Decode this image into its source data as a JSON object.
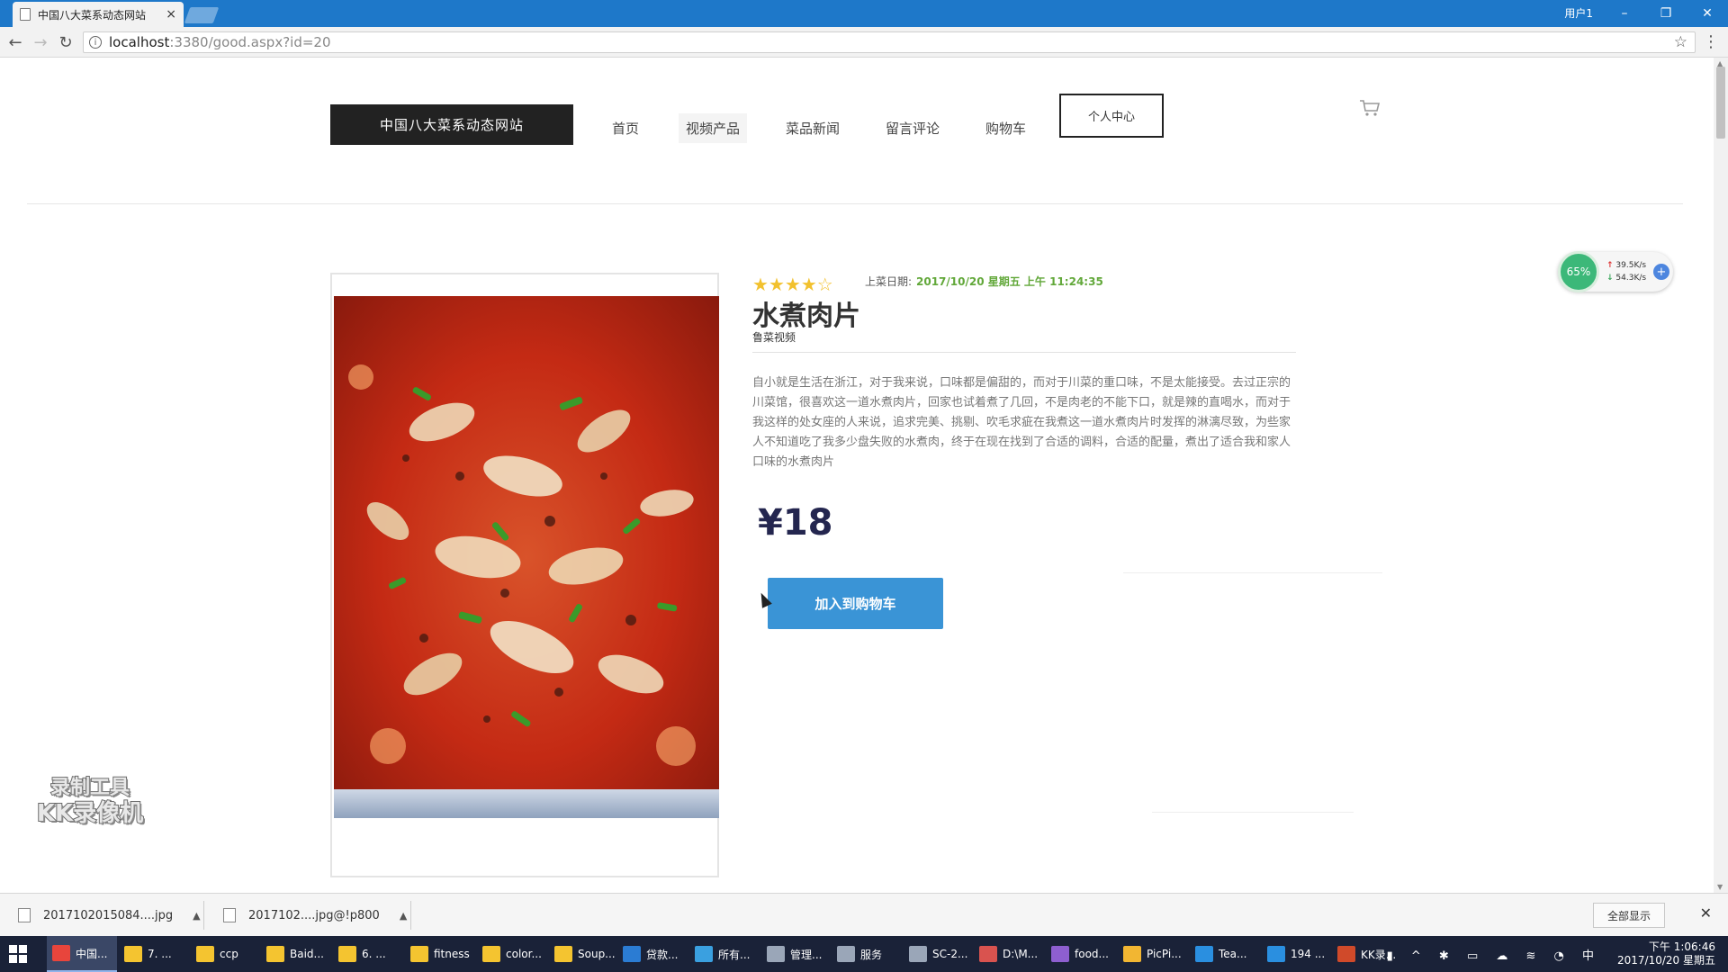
{
  "browser": {
    "tab_title": "中国八大菜系动态网站",
    "tab_close": "×",
    "user_label": "用户1",
    "window_buttons": [
      "–",
      "❐",
      "✕"
    ],
    "url_host": "localhost",
    "url_path": ":3380/good.aspx?id=20",
    "back": "←",
    "forward": "→",
    "reload": "↻",
    "star": "☆",
    "menu": "⋮"
  },
  "site": {
    "logo_text": "中国八大菜系动态网站",
    "nav": [
      "首页",
      "视频产品",
      "菜品新闻",
      "留言评论",
      "购物车"
    ],
    "personal_center": "个人中心",
    "cart_icon": "shopping-cart-icon"
  },
  "product": {
    "rating": 4,
    "rating_max": 5,
    "release_label": "上菜日期:",
    "release_date": "2017/10/20 星期五 上午 11:24:35",
    "title": "水煮肉片",
    "category": "鲁菜视频",
    "description": "自小就是生活在浙江，对于我来说，口味都是偏甜的，而对于川菜的重口味，不是太能接受。去过正宗的川菜馆，很喜欢这一道水煮肉片，回家也试着煮了几回，不是肉老的不能下口，就是辣的直喝水，而对于我这样的处女座的人来说，追求完美、挑剔、吹毛求疵在我煮这一道水煮肉片时发挥的淋漓尽致，为些家人不知道吃了我多少盘失败的水煮肉，终于在现在找到了合适的调料，合适的配量，煮出了适合我和家人口味的水煮肉片",
    "price": "¥18",
    "add_to_cart": "加入到购物车"
  },
  "net_widget": {
    "percent": "65%",
    "up": "39.5K/s",
    "down": "54.3K/s",
    "plus": "+"
  },
  "watermark": {
    "line1": "录制工具",
    "line2": "KK录像机"
  },
  "downloads": {
    "items": [
      {
        "name": "2017102015084....jpg"
      },
      {
        "name": "2017102....jpg@!p800"
      }
    ],
    "show_all": "全部显示",
    "close": "✕"
  },
  "taskbar": {
    "tasks": [
      {
        "label": "中国...",
        "color": "#e8453c"
      },
      {
        "label": "7. ...",
        "color": "#f4c430"
      },
      {
        "label": "ccp",
        "color": "#f4c430"
      },
      {
        "label": "Baid...",
        "color": "#f4c430"
      },
      {
        "label": "6. ...",
        "color": "#f4c430"
      },
      {
        "label": "fitness",
        "color": "#f4c430"
      },
      {
        "label": "color...",
        "color": "#f4c430"
      },
      {
        "label": "Soup...",
        "color": "#f4c430"
      },
      {
        "label": "贷款...",
        "color": "#2b7cd3"
      },
      {
        "label": "所有...",
        "color": "#3aa0e0"
      },
      {
        "label": "管理...",
        "color": "#9aa6b8"
      },
      {
        "label": "服务",
        "color": "#9aa6b8"
      },
      {
        "label": "SC-2...",
        "color": "#9aa6b8"
      },
      {
        "label": "D:\\M...",
        "color": "#d9534f"
      },
      {
        "label": "food...",
        "color": "#8e5fd0"
      },
      {
        "label": "PicPi...",
        "color": "#f2b632"
      },
      {
        "label": "Tea...",
        "color": "#2a8fe0"
      },
      {
        "label": "194 ...",
        "color": "#2a8fe0"
      },
      {
        "label": "KK录...",
        "color": "#d04a2a"
      }
    ],
    "tray_icons": "▮ ^ ✱ ▭ ☁ ≋ ◔ 中",
    "time": "下午 1:06:46",
    "date": "2017/10/20 星期五"
  }
}
